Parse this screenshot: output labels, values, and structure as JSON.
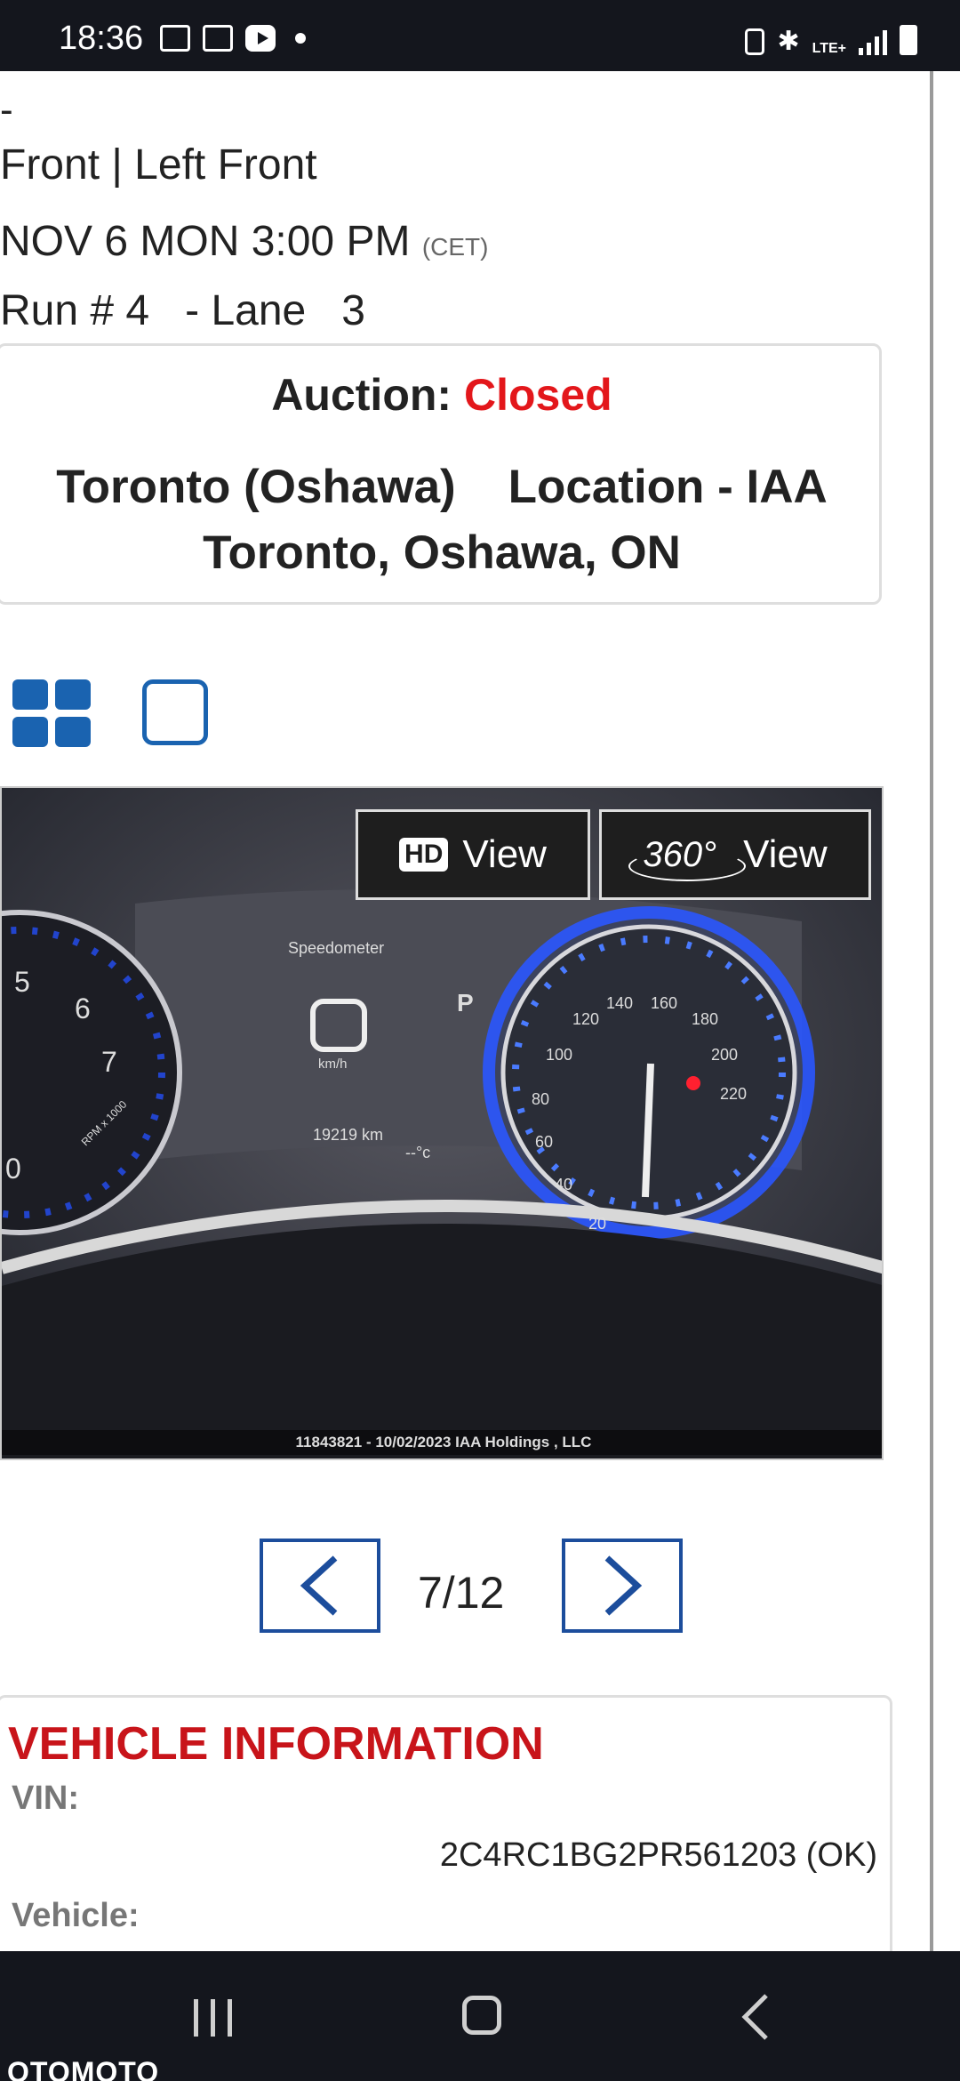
{
  "status_bar": {
    "time": "18:36",
    "network": "LTE+"
  },
  "header": {
    "dash": "-",
    "position": "Front | Left Front",
    "sale_date": "NOV 6 MON 3:00 PM",
    "timezone": "(CET)",
    "run_lane": "Run # 4   - Lane   3"
  },
  "auction": {
    "label": "Auction:",
    "status": "Closed",
    "location_line1": "Toronto (Oshawa)    Location - IAA",
    "location_line2": "Toronto, Oshawa, ON"
  },
  "gallery": {
    "hd_label": "HD",
    "hd_view": "View",
    "view360_label": "360°",
    "view360_view": "View",
    "caption": "11843821 - 10/02/2023 IAA Holdings , LLC",
    "dashboard": {
      "speedometer_label": "Speedometer",
      "unit": "km/h",
      "odometer": "19219 km",
      "temp": "--°c",
      "gear": "P",
      "speed_ticks": [
        "20",
        "40",
        "60",
        "80",
        "100",
        "120",
        "140",
        "160",
        "180",
        "200",
        "220"
      ],
      "rpm_ticks": [
        "0",
        "5",
        "6",
        "7"
      ],
      "rpm_label": "RPM x 1000"
    },
    "counter": "7/12"
  },
  "vehicle_info": {
    "title": "VEHICLE INFORMATION",
    "vin_label": "VIN:",
    "vin_value": "2C4RC1BG2PR561203 (OK)",
    "vehicle_label": "Vehicle:"
  },
  "nav": {
    "watermark": "OTOMOTO"
  },
  "colors": {
    "accent_blue": "#1a63b0",
    "closed_red": "#e3171b",
    "title_red": "#c8141a"
  }
}
